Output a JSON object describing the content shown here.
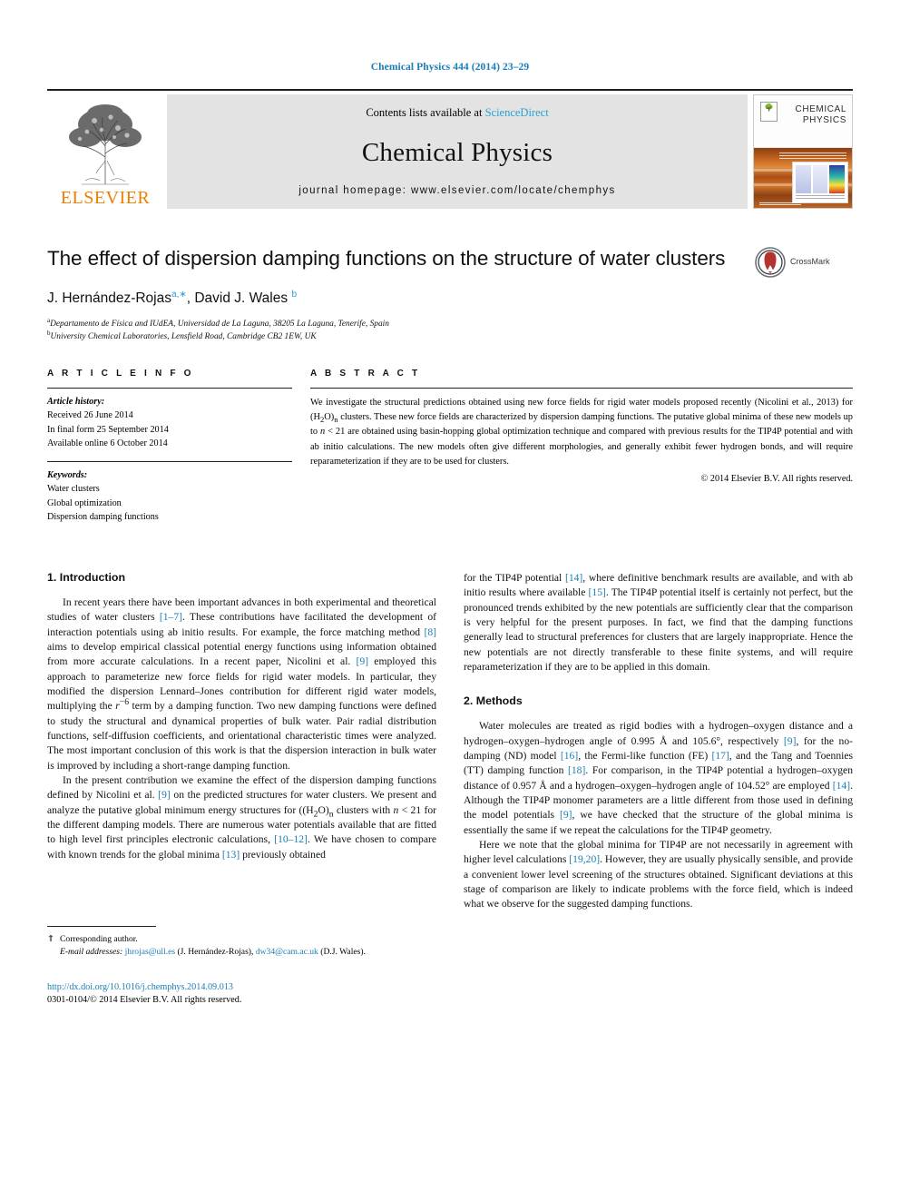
{
  "running_head": "Chemical Physics 444 (2014) 23–29",
  "masthead": {
    "contents_prefix": "Contents lists available at ",
    "sciencedirect": "ScienceDirect",
    "journal_title": "Chemical Physics",
    "homepage": "journal homepage: www.elsevier.com/locate/chemphys",
    "publisher": "ELSEVIER",
    "cover_title_line1": "CHEMICAL",
    "cover_title_line2": "PHYSICS",
    "cover_logo_mark": "ELSEVIER"
  },
  "title_block": {
    "title": "The effect of dispersion damping functions on the structure of water clusters",
    "authors_html": "J. Hernández-Rojas, David J. Wales",
    "author1": "J. Hernández-Rojas",
    "author1_marks": "a,∗",
    "author2": "David J. Wales",
    "author2_marks": "b",
    "affiliation_a_mark": "a",
    "affiliation_a": "Departamento de Física and IUdEA, Universidad de La Laguna, 38205 La Laguna, Tenerife, Spain",
    "affiliation_b_mark": "b",
    "affiliation_b": "University Chemical Laboratories, Lensfield Road, Cambridge CB2 1EW, UK",
    "crossmark_label": "CrossMark"
  },
  "article_info": {
    "heading": "A R T I C L E   I N F O",
    "history_label": "Article history:",
    "history": [
      "Received 26 June 2014",
      "In final form 25 September 2014",
      "Available online 6 October 2014"
    ],
    "keywords_label": "Keywords:",
    "keywords": [
      "Water clusters",
      "Global optimization",
      "Dispersion damping functions"
    ]
  },
  "abstract": {
    "heading": "A B S T R A C T",
    "text": "We investigate the structural predictions obtained using new force fields for rigid water models proposed recently (Nicolini et al., 2013) for (H2O)n clusters. These new force fields are characterized by dispersion damping functions. The putative global minima of these new models up to n < 21 are obtained using basin-hopping global optimization technique and compared with previous results for the TIP4P potential and with ab initio calculations. The new models often give different morphologies, and generally exhibit fewer hydrogen bonds, and will require reparameterization if they are to be used for clusters.",
    "copyright": "© 2014 Elsevier B.V. All rights reserved."
  },
  "sections": {
    "introduction_heading": "1. Introduction",
    "intro_p1": "In recent years there have been important advances in both experimental and theoretical studies of water clusters [1–7]. These contributions have facilitated the development of interaction potentials using ab initio results. For example, the force matching method [8] aims to develop empirical classical potential energy functions using information obtained from more accurate calculations. In a recent paper, Nicolini et al. [9] employed this approach to parameterize new force fields for rigid water models. In particular, they modified the dispersion Lennard–Jones contribution for different rigid water models, multiplying the r−6 term by a damping function. Two new damping functions were defined to study the structural and dynamical properties of bulk water. Pair radial distribution functions, self-diffusion coefficients, and orientational characteristic times were analyzed. The most important conclusion of this work is that the dispersion interaction in bulk water is improved by including a short-range damping function.",
    "intro_p2": "In the present contribution we examine the effect of the dispersion damping functions defined by Nicolini et al. [9] on the predicted structures for water clusters. We present and analyze the putative global minimum energy structures for ((H2O)n clusters with n < 21 for the different damping models. There are numerous water potentials available that are fitted to high level first principles electronic calculations, [10–12]. We have chosen to compare with known trends for the global minima [13] previously obtained",
    "intro_p3": "for the TIP4P potential [14], where definitive benchmark results are available, and with ab initio results where available [15]. The TIP4P potential itself is certainly not perfect, but the pronounced trends exhibited by the new potentials are sufficiently clear that the comparison is very helpful for the present purposes. In fact, we find that the damping functions generally lead to structural preferences for clusters that are largely inappropriate. Hence the new potentials are not directly transferable to these finite systems, and will require reparameterization if they are to be applied in this domain.",
    "methods_heading": "2. Methods",
    "methods_p1": "Water molecules are treated as rigid bodies with a hydrogen–oxygen distance and a hydrogen–oxygen–hydrogen angle of 0.995 Å and 105.6°, respectively [9], for the no-damping (ND) model [16], the Fermi-like function (FE) [17], and the Tang and Toennies (TT) damping function [18]. For comparison, in the TIP4P potential a hydrogen–oxygen distance of 0.957 Å and a hydrogen–oxygen–hydrogen angle of 104.52° are employed [14]. Although the TIP4P monomer parameters are a little different from those used in defining the model potentials [9], we have checked that the structure of the global minima is essentially the same if we repeat the calculations for the TIP4P geometry.",
    "methods_p2": "Here we note that the global minima for TIP4P are not necessarily in agreement with higher level calculations [19,20]. However, they are usually physically sensible, and provide a convenient lower level screening of the structures obtained. Significant deviations at this stage of comparison are likely to indicate problems with the force field, which is indeed what we observe for the suggested damping functions."
  },
  "footnotes": {
    "corresponding_mark": "⇑",
    "corresponding": "Corresponding author.",
    "email_label": "E-mail addresses:",
    "email1": "jhrojas@ull.es",
    "email1_owner": "(J. Hernández-Rojas),",
    "email2": "dw34@cam.ac.uk",
    "email2_owner": "(D.J. Wales).",
    "doi": "http://dx.doi.org/10.1016/j.chemphys.2014.09.013",
    "issn_line": "0301-0104/© 2014 Elsevier B.V. All rights reserved."
  },
  "colors": {
    "link_blue": "#1a7db5",
    "sciencedirect_blue": "#2a9fd6",
    "elsevier_orange": "#ef7d00",
    "crossmark_red": "#b5332e"
  }
}
